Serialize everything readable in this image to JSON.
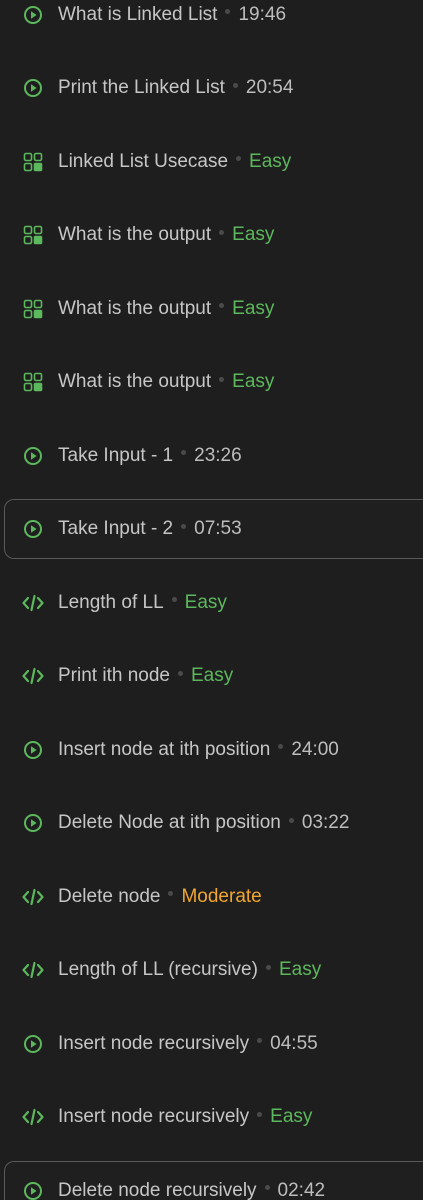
{
  "colors": {
    "accent_green": "#5cb85c",
    "moderate_orange": "#f0a630",
    "background": "#1e1e1e"
  },
  "items": [
    {
      "icon": "play-circle-icon",
      "title": "What is Linked List",
      "meta": "19:46",
      "meta_type": "time"
    },
    {
      "icon": "play-circle-icon",
      "title": "Print the Linked List",
      "meta": "20:54",
      "meta_type": "time"
    },
    {
      "icon": "quiz-grid-icon",
      "title": "Linked List Usecase",
      "meta": "Easy",
      "meta_type": "easy"
    },
    {
      "icon": "quiz-grid-icon",
      "title": "What is the output",
      "meta": "Easy",
      "meta_type": "easy"
    },
    {
      "icon": "quiz-grid-icon",
      "title": "What is the output",
      "meta": "Easy",
      "meta_type": "easy"
    },
    {
      "icon": "quiz-grid-icon",
      "title": "What is the output",
      "meta": "Easy",
      "meta_type": "easy"
    },
    {
      "icon": "play-circle-icon",
      "title": "Take Input - 1",
      "meta": "23:26",
      "meta_type": "time"
    },
    {
      "icon": "play-circle-icon",
      "title": "Take Input - 2",
      "meta": "07:53",
      "meta_type": "time",
      "selected": true
    },
    {
      "icon": "code-icon",
      "title": "Length of LL",
      "meta": "Easy",
      "meta_type": "easy"
    },
    {
      "icon": "code-icon",
      "title": "Print ith node",
      "meta": "Easy",
      "meta_type": "easy"
    },
    {
      "icon": "play-circle-icon",
      "title": "Insert node at ith position",
      "meta": "24:00",
      "meta_type": "time"
    },
    {
      "icon": "play-circle-icon",
      "title": "Delete Node at ith position",
      "meta": "03:22",
      "meta_type": "time"
    },
    {
      "icon": "code-icon",
      "title": "Delete node",
      "meta": "Moderate",
      "meta_type": "moderate"
    },
    {
      "icon": "code-icon",
      "title": "Length of LL (recursive)",
      "meta": "Easy",
      "meta_type": "easy"
    },
    {
      "icon": "play-circle-icon",
      "title": "Insert node recursively",
      "meta": "04:55",
      "meta_type": "time"
    },
    {
      "icon": "code-icon",
      "title": "Insert node recursively",
      "meta": "Easy",
      "meta_type": "easy"
    },
    {
      "icon": "play-circle-icon",
      "title": "Delete node recursively",
      "meta": "02:42",
      "meta_type": "time",
      "selected": true
    }
  ]
}
